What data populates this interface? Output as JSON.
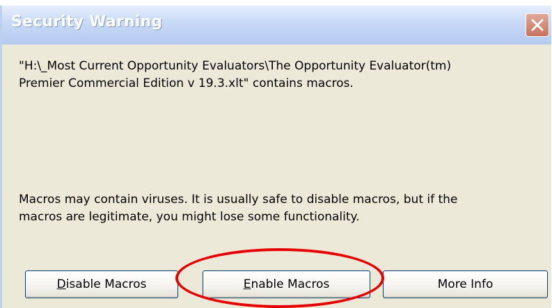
{
  "window": {
    "title": "Security Warning",
    "close_icon": "close-x-icon"
  },
  "message": {
    "file_notice": "\"H:\\_Most Current Opportunity Evaluators\\The Opportunity Evaluator(tm)\nPremier Commercial Edition v 19.3.xlt\" contains macros.",
    "warning": "Macros may contain viruses. It is usually safe to disable macros, but if the\nmacros are legitimate, you might lose some functionality."
  },
  "buttons": {
    "disable": {
      "accel": "D",
      "rest": "isable Macros"
    },
    "enable": {
      "accel": "E",
      "rest": "nable Macros"
    },
    "more_info": {
      "accel": "",
      "rest": "More Info"
    }
  },
  "annotation": {
    "highlight_color": "#E60000",
    "highlighted_target": "enable-macros-button"
  },
  "colors": {
    "dialog_background": "#ECE9D8",
    "title_bar": "#C8D9F6",
    "close_button": "#C7735C",
    "button_border": "#003C74"
  }
}
